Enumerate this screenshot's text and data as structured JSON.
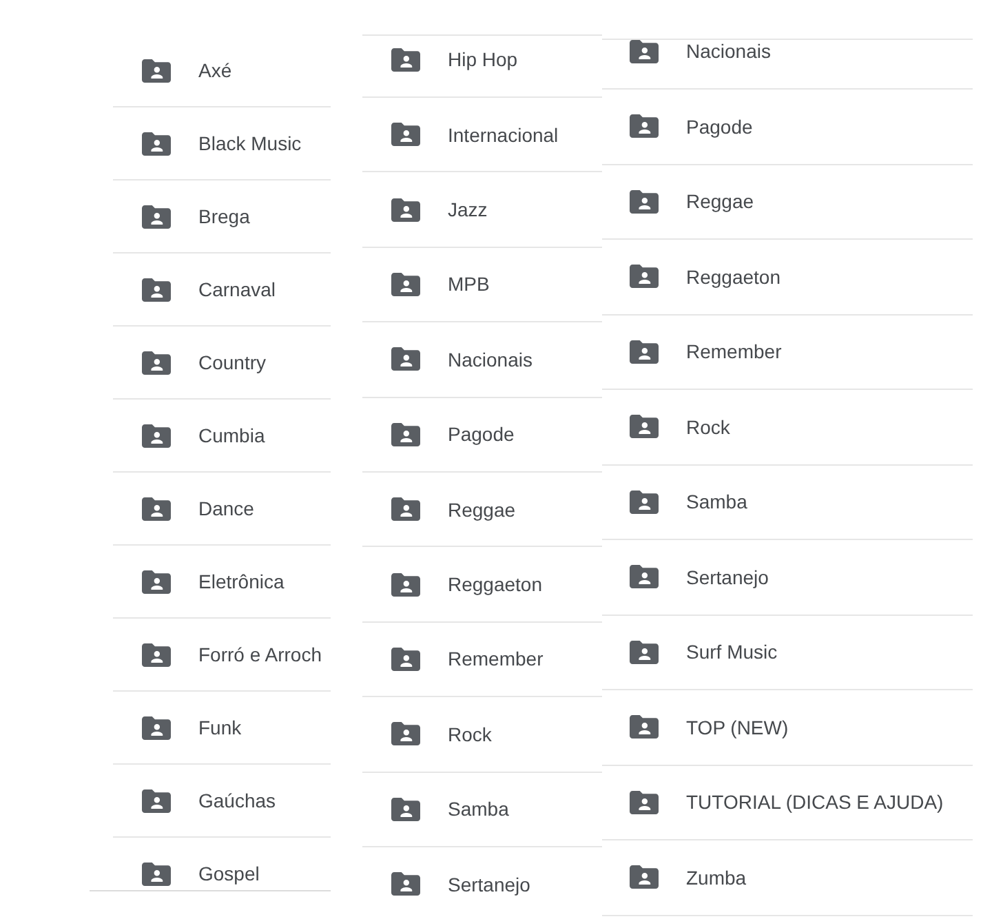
{
  "columns": [
    {
      "items": [
        {
          "label": "Axé"
        },
        {
          "label": "Black Music"
        },
        {
          "label": "Brega"
        },
        {
          "label": "Carnaval"
        },
        {
          "label": "Country"
        },
        {
          "label": "Cumbia"
        },
        {
          "label": "Dance"
        },
        {
          "label": "Eletrônica"
        },
        {
          "label": "Forró e Arroch"
        },
        {
          "label": "Funk"
        },
        {
          "label": "Gaúchas"
        },
        {
          "label": "Gospel"
        }
      ]
    },
    {
      "items": [
        {
          "label": "Hip Hop"
        },
        {
          "label": "Internacional"
        },
        {
          "label": "Jazz"
        },
        {
          "label": "MPB"
        },
        {
          "label": "Nacionais"
        },
        {
          "label": "Pagode"
        },
        {
          "label": "Reggae"
        },
        {
          "label": "Reggaeton"
        },
        {
          "label": "Remember"
        },
        {
          "label": "Rock"
        },
        {
          "label": "Samba"
        },
        {
          "label": "Sertanejo"
        }
      ]
    },
    {
      "items": [
        {
          "label": "Nacionais"
        },
        {
          "label": "Pagode"
        },
        {
          "label": "Reggae"
        },
        {
          "label": "Reggaeton"
        },
        {
          "label": "Remember"
        },
        {
          "label": "Rock"
        },
        {
          "label": "Samba"
        },
        {
          "label": "Sertanejo"
        },
        {
          "label": "Surf Music"
        },
        {
          "label": "TOP (NEW)"
        },
        {
          "label": "TUTORIAL (DICAS E AJUDA)"
        },
        {
          "label": "Zumba"
        }
      ]
    }
  ]
}
